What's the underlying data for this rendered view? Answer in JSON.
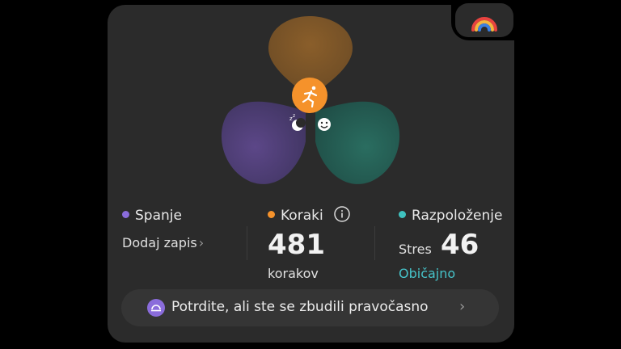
{
  "colors": {
    "sleep": "#8a6cdb",
    "steps": "#f5922b",
    "mood": "#3fc2bf",
    "accent_text": "#46c2c8"
  },
  "icons": {
    "badge": "rainbow-icon",
    "activity": "running-person-icon",
    "sleep": "moon-sleep-icon",
    "mood": "smiley-icon",
    "info": "info-icon",
    "pill": "sunrise-icon"
  },
  "sleep": {
    "label": "Spanje",
    "action": "Dodaj zapis"
  },
  "steps": {
    "label": "Koraki",
    "value": "481",
    "unit": "korakov"
  },
  "mood": {
    "label": "Razpoloženje",
    "stress_label": "Stres",
    "stress_value": "46",
    "status": "Običajno"
  },
  "prompt": {
    "text": "Potrdite, ali ste se zbudili pravočasno"
  }
}
